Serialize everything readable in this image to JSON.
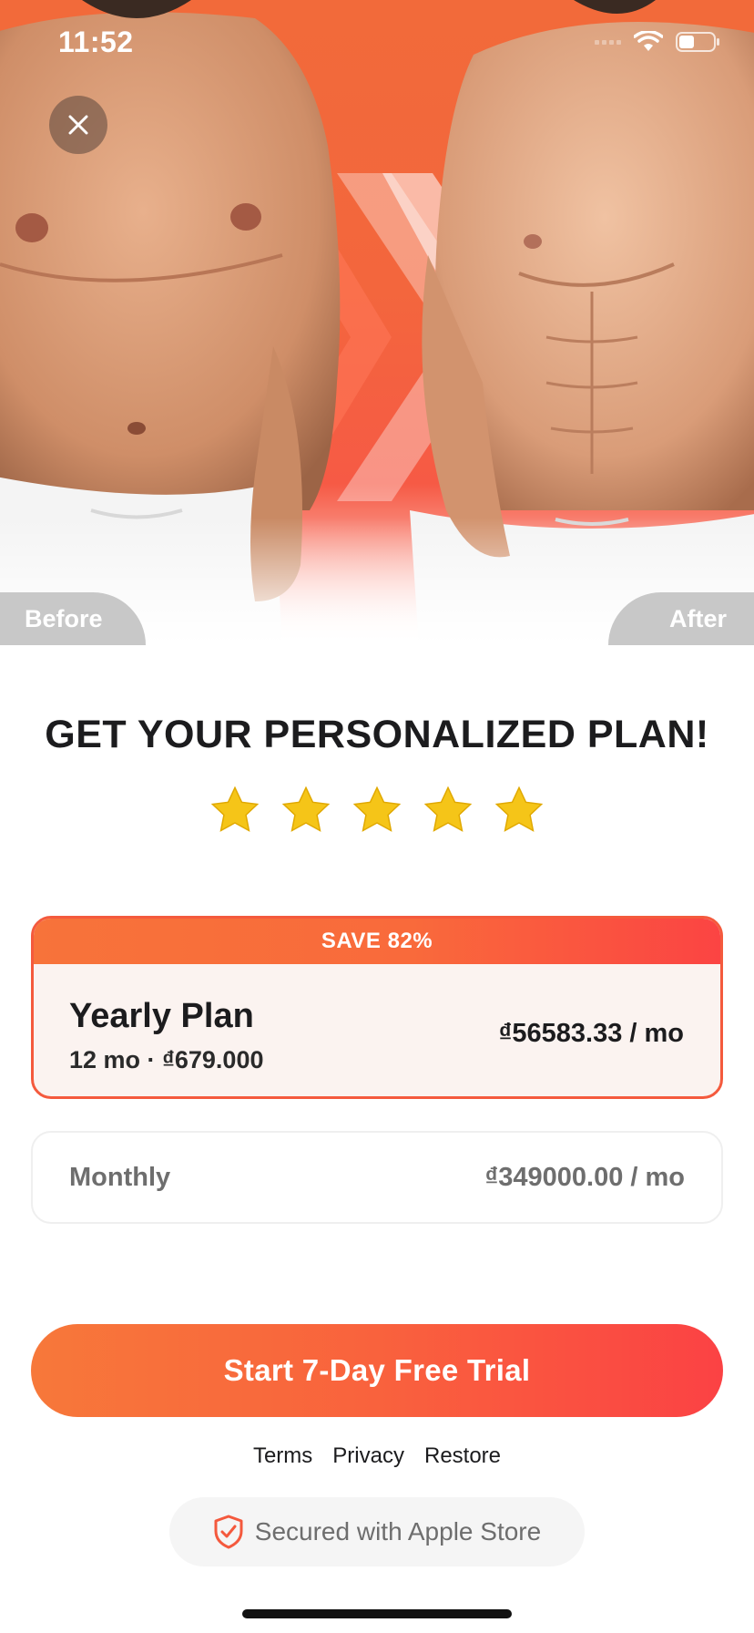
{
  "status_bar": {
    "time": "11:52"
  },
  "hero": {
    "before_label": "Before",
    "after_label": "After",
    "close_icon": "close-icon",
    "accent_color": "#f26a3a"
  },
  "headline": "GET YOUR PERSONALIZED PLAN!",
  "rating": {
    "stars": 5,
    "icon": "star-icon",
    "color": "#f5c518"
  },
  "plans": {
    "yearly": {
      "badge": "SAVE 82%",
      "name": "Yearly Plan",
      "subtitle": "12 mo · ₫679.000",
      "price": "₫56583.33 / mo",
      "selected": true
    },
    "monthly": {
      "name": "Monthly",
      "price": "₫349000.00 / mo",
      "selected": false
    }
  },
  "cta": {
    "label": "Start 7-Day Free Trial",
    "gradient": [
      "#f7783a",
      "#fb4244"
    ]
  },
  "footer_links": {
    "terms": "Terms",
    "privacy": "Privacy",
    "restore": "Restore"
  },
  "secure_badge": {
    "icon": "shield-check-icon",
    "label": "Secured with Apple Store"
  }
}
